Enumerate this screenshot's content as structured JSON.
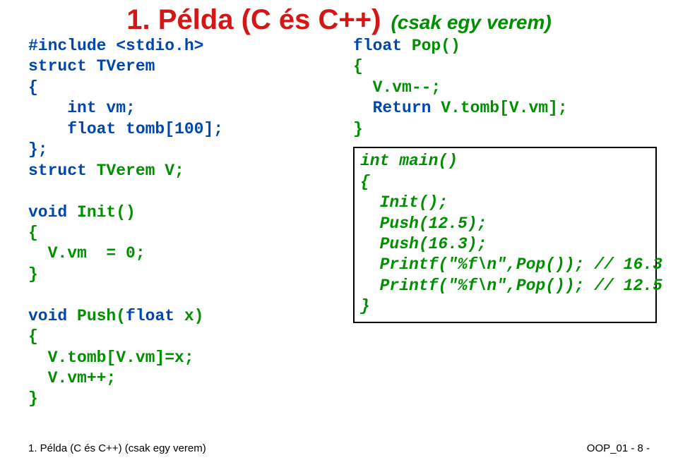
{
  "title": {
    "main": "1. Példa (C és C++)",
    "sub": "(csak egy verem)"
  },
  "left": {
    "l1": "#include <stdio.h>",
    "l2": "struct TVerem",
    "l3": "{",
    "l4": "    int vm;",
    "l5": "    float tomb[100];",
    "l6": "};",
    "l7a": "struct",
    "l7b": " TVerem V;",
    "l8a": "void",
    "l8b": " Init()",
    "l9": "{",
    "l10": "  V.vm  = 0;",
    "l11": "}",
    "l12a": "void",
    "l12b": " Push(",
    "l12c": "float",
    "l12d": " x)",
    "l13": "{",
    "l14": "  V.tomb[V.vm]=x;",
    "l15": "  V.vm++;",
    "l16": "}"
  },
  "right": {
    "r1a": "float",
    "r1b": " Pop()",
    "r2": "{",
    "r3": "  V.vm--;",
    "r4a": "  ",
    "r4b": "Return",
    "r4c": " V.tomb[V.vm];",
    "r5": "}",
    "m1": "int main()",
    "m2": "{",
    "m3": "  Init();",
    "m4": "  Push(12.5);",
    "m5": "  Push(16.3);",
    "m6": "  Printf(\"%f\\n\",Pop()); // 16.3",
    "m7": "  Printf(\"%f\\n\",Pop()); // 12.5",
    "m8": "}"
  },
  "footer": {
    "left": "1. Példa (C és C++) (csak egy verem)",
    "right": "OOP_01     - 8 -"
  }
}
